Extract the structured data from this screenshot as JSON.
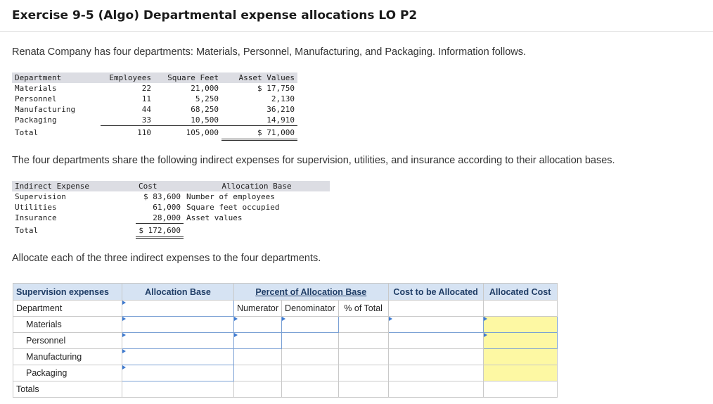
{
  "title": "Exercise 9-5 (Algo) Departmental expense allocations LO P2",
  "intro": "Renata Company has four departments: Materials, Personnel, Manufacturing, and Packaging. Information follows.",
  "dept_table": {
    "headers": [
      "Department",
      "Employees",
      "Square Feet",
      "Asset Values"
    ],
    "rows": [
      [
        "Materials",
        "22",
        "21,000",
        "$ 17,750"
      ],
      [
        "Personnel",
        "11",
        "5,250",
        "2,130"
      ],
      [
        "Manufacturing",
        "44",
        "68,250",
        "36,210"
      ],
      [
        "Packaging",
        "33",
        "10,500",
        "14,910"
      ]
    ],
    "total": [
      "Total",
      "110",
      "105,000",
      "$ 71,000"
    ]
  },
  "share_text": "The four departments share the following indirect expenses for supervision, utilities, and insurance according to their allocation bases.",
  "indirect_table": {
    "headers": [
      "Indirect Expense",
      "Cost",
      "Allocation Base"
    ],
    "rows": [
      [
        "Supervision",
        "$ 83,600",
        "Number of employees"
      ],
      [
        "Utilities",
        "61,000",
        "Square feet occupied"
      ],
      [
        "Insurance",
        "28,000",
        "Asset values"
      ]
    ],
    "total": [
      "Total",
      "$ 172,600"
    ]
  },
  "allocate_text": "Allocate each of the three indirect expenses to the four departments.",
  "grid": {
    "h1": "Supervision expenses",
    "h2": "Allocation Base",
    "h3": "Percent of Allocation Base",
    "h4": "Cost to be Allocated",
    "h5": "Allocated Cost",
    "sub_dept": "Department",
    "sub_num": "Numerator",
    "sub_den": "Denominator",
    "sub_pct": "% of Total",
    "rows": [
      "Materials",
      "Personnel",
      "Manufacturing",
      "Packaging"
    ],
    "totals": "Totals"
  }
}
